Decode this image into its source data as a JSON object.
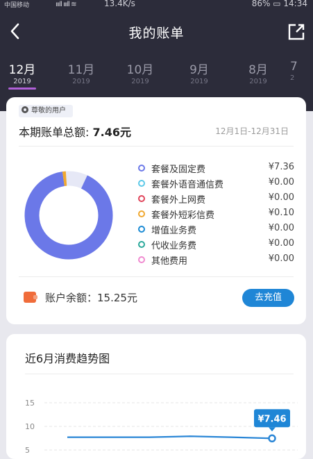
{
  "status": {
    "carrier": "中国移动",
    "speed": "13.4K/s",
    "battery": "86%",
    "time": "14:34",
    "bars": "ıııll ıııll ≋"
  },
  "nav": {
    "title": "我的账单"
  },
  "months": [
    {
      "month": "12月",
      "year": "2019",
      "active": true
    },
    {
      "month": "11月",
      "year": "2019",
      "active": false
    },
    {
      "month": "10月",
      "year": "2019",
      "active": false
    },
    {
      "month": "9月",
      "year": "2019",
      "active": false
    },
    {
      "month": "8月",
      "year": "2019",
      "active": false
    },
    {
      "month": "7",
      "year": "2",
      "active": false
    }
  ],
  "summary": {
    "badge": "尊敬的用户",
    "total_label": "本期账单总额: ",
    "total_value": "7.46元",
    "period": "12月1日-12月31日"
  },
  "legend": [
    {
      "name": "套餐及固定费",
      "value": "¥7.36",
      "color": "#6b78e8"
    },
    {
      "name": "套餐外语音通信费",
      "value": "¥0.00",
      "color": "#5cc9e8"
    },
    {
      "name": "套餐外上网费",
      "value": "¥0.00",
      "color": "#e0445a"
    },
    {
      "name": "套餐外短彩信费",
      "value": "¥0.10",
      "color": "#f0a830"
    },
    {
      "name": "增值业务费",
      "value": "¥0.00",
      "color": "#1a8ad4"
    },
    {
      "name": "代收业务费",
      "value": "¥0.00",
      "color": "#2aa89a"
    },
    {
      "name": "其他费用",
      "value": "¥0.00",
      "color": "#f08ad0"
    }
  ],
  "donut": {
    "slices": [
      7.36,
      0.1
    ],
    "remainder": "#e6e8f6"
  },
  "balance": {
    "label": "账户余额：",
    "value": "15.25元",
    "button": "去充值"
  },
  "trend": {
    "title": "近6月消费趋势图",
    "chart_data": {
      "type": "line",
      "ylim": [
        5,
        15
      ],
      "yticks": [
        "15",
        "10",
        "5"
      ],
      "values": [
        7.7,
        7.7,
        7.7,
        7.9,
        7.7,
        7.46
      ],
      "highlight_label": "¥7.46"
    }
  }
}
